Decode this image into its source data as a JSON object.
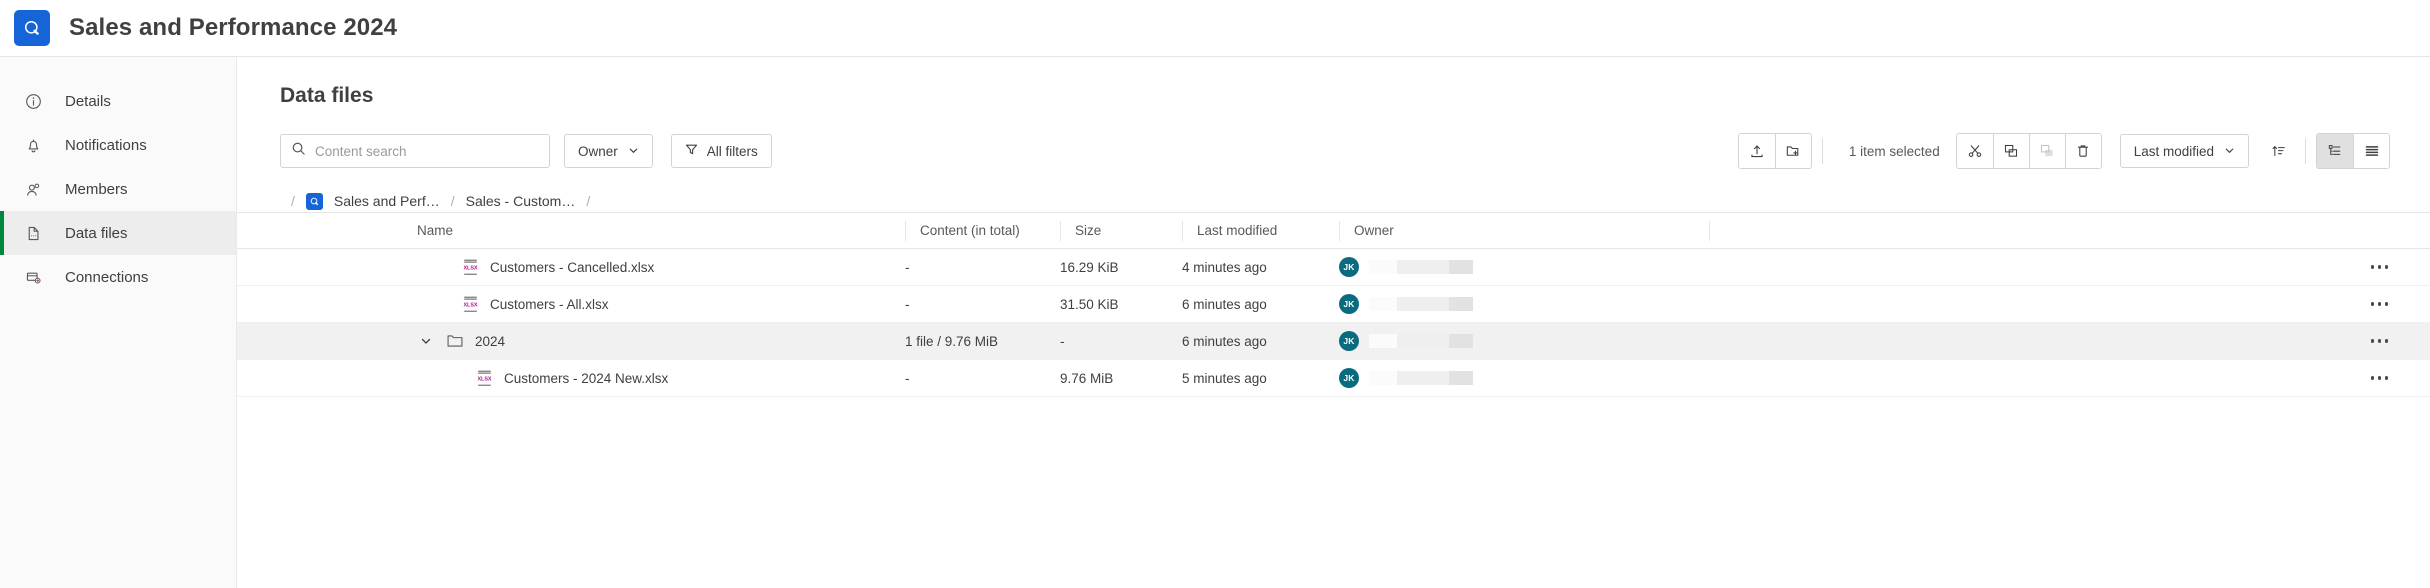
{
  "header": {
    "app_logo_icon": "qlik-circle-logo-icon",
    "title": "Sales and Performance 2024"
  },
  "sidebar": {
    "items": [
      {
        "label": "Details",
        "icon": "info-circle-icon",
        "active": false
      },
      {
        "label": "Notifications",
        "icon": "bell-icon",
        "active": false
      },
      {
        "label": "Members",
        "icon": "people-icon",
        "active": false
      },
      {
        "label": "Data files",
        "icon": "document-icon",
        "active": true
      },
      {
        "label": "Connections",
        "icon": "connections-icon",
        "active": false
      }
    ]
  },
  "main": {
    "page_title": "Data files",
    "toolbar": {
      "search_placeholder": "Content search",
      "search_value": "",
      "search_icon": "search-icon",
      "owner_label": "Owner",
      "owner_chevron_icon": "chevron-down-icon",
      "all_filters_label": "All filters",
      "filter_icon": "funnel-icon",
      "upload_icon": "upload-icon",
      "new_folder_icon": "new-folder-icon",
      "selection_text": "1 item selected",
      "cut_icon": "scissors-icon",
      "copy_icon": "copy-icon",
      "paste_icon": "paste-icon",
      "delete_icon": "trash-icon",
      "sort_label": "Last modified",
      "sort_chevron_icon": "chevron-down-icon",
      "sort_direction_icon": "sort-ascending-icon",
      "tree_view_icon": "tree-view-icon",
      "list_view_icon": "list-view-icon",
      "active_view": "tree"
    },
    "breadcrumb": {
      "leading_separator": "/",
      "space_icon": "qlik-space-icon",
      "items": [
        {
          "label": "Sales and Perf…"
        },
        {
          "label": "Sales - Custom…"
        }
      ],
      "separator": "/",
      "trailing_separator": "/"
    },
    "table": {
      "columns": [
        "Name",
        "Content (in total)",
        "Size",
        "Last modified",
        "Owner"
      ],
      "rows": [
        {
          "name": "Customers - Cancelled.xlsx",
          "type": "file",
          "icon": "xlsx-file-icon",
          "indent": 1,
          "content": "-",
          "size": "16.29 KiB",
          "modified": "4 minutes ago",
          "owner_initials": "JK",
          "selected": false,
          "menu_icon": "more-options-icon"
        },
        {
          "name": "Customers - All.xlsx",
          "type": "file",
          "icon": "xlsx-file-icon",
          "indent": 1,
          "content": "-",
          "size": "31.50 KiB",
          "modified": "6 minutes ago",
          "owner_initials": "JK",
          "selected": false,
          "menu_icon": "more-options-icon"
        },
        {
          "name": "2024",
          "type": "folder",
          "icon": "folder-icon",
          "expanded": true,
          "expand_icon": "chevron-down-icon",
          "indent": 0,
          "content": "1 file / 9.76 MiB",
          "size": "-",
          "modified": "6 minutes ago",
          "owner_initials": "JK",
          "selected": true,
          "menu_icon": "more-options-icon"
        },
        {
          "name": "Customers - 2024 New.xlsx",
          "type": "file",
          "icon": "xlsx-file-icon",
          "indent": 2,
          "content": "-",
          "size": "9.76 MiB",
          "modified": "5 minutes ago",
          "owner_initials": "JK",
          "selected": false,
          "menu_icon": "more-options-icon"
        }
      ]
    }
  },
  "colors": {
    "brand_blue": "#1565d8",
    "accent_green": "#00873d",
    "avatar_teal": "#0a6b7f",
    "xlsx_magenta": "#b0178c"
  }
}
